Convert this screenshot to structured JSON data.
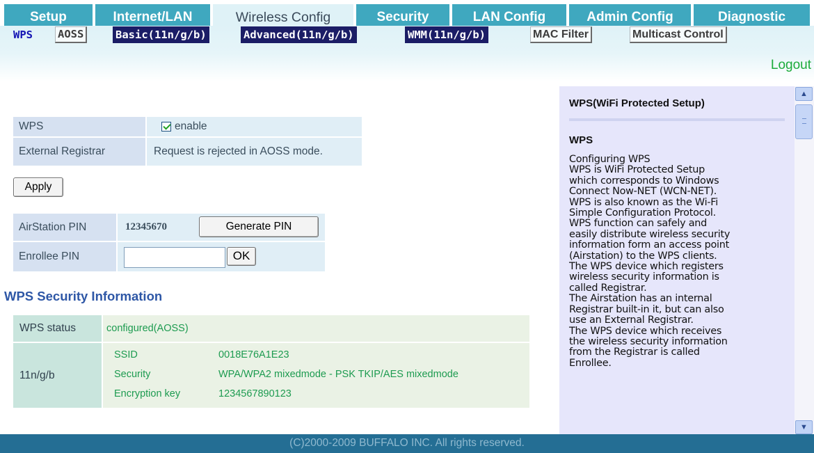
{
  "topnav": {
    "tabs": [
      {
        "label": "Setup",
        "active": false
      },
      {
        "label": "Internet/LAN",
        "active": false
      },
      {
        "label": "Wireless Config",
        "active": true
      },
      {
        "label": "Security",
        "active": false
      },
      {
        "label": "LAN Config",
        "active": false
      },
      {
        "label": "Admin Config",
        "active": false
      },
      {
        "label": "Diagnostic",
        "active": false
      }
    ]
  },
  "subnav": {
    "items": [
      {
        "label": "WPS",
        "style": "active"
      },
      {
        "label": "AOSS",
        "style": "plain"
      },
      {
        "label": "Basic(11n/g/b)",
        "style": "dark"
      },
      {
        "label": "Advanced(11n/g/b)",
        "style": "dark"
      },
      {
        "label": "WMM(11n/g/b)",
        "style": "dark"
      },
      {
        "label": "MAC Filter",
        "style": "plain-sans"
      },
      {
        "label": "Multicast Control",
        "style": "plain-sans"
      }
    ],
    "logout_label": "Logout"
  },
  "wps_form": {
    "wps_label": "WPS",
    "wps_enabled": true,
    "wps_enable_text": "enable",
    "external_registrar_label": "External Registrar",
    "external_registrar_value": "Request is rejected in AOSS mode.",
    "apply_label": "Apply",
    "airstation_pin_label": "AirStation PIN",
    "airstation_pin_value": "12345670",
    "generate_pin_label": "Generate PIN",
    "enrollee_pin_label": "Enrollee PIN",
    "enrollee_pin_value": "",
    "ok_label": "OK"
  },
  "security_info": {
    "title": "WPS Security Information",
    "status_label": "WPS status",
    "status_value": "configured(AOSS)",
    "band_label": "11n/g/b",
    "ssid_label": "SSID",
    "ssid_value": "0018E76A1E23",
    "security_label": "Security",
    "security_value": "WPA/WPA2 mixedmode - PSK TKIP/AES mixedmode",
    "key_label": "Encryption key",
    "key_value": "1234567890123"
  },
  "help": {
    "title": "WPS(WiFi Protected Setup)",
    "subtitle": "WPS",
    "lines": [
      "Configuring WPS",
      "WPS is WiFi Protected Setup",
      "which corresponds to Windows",
      "Connect Now-NET (WCN-NET).",
      "WPS is also known as the Wi-Fi",
      "Simple Configuration Protocol.",
      "WPS function can safely and",
      "easily distribute wireless security",
      "information form an access point",
      "(Airstation) to the WPS clients.",
      "The WPS device which registers",
      "wireless security information is",
      "called Registrar.",
      "The Airstation has an internal",
      "Registrar built-in it, but can also",
      "use an External Registrar.",
      "The WPS device which receives",
      "the wireless security information",
      "from the Registrar is called",
      "Enrollee."
    ]
  },
  "footer": {
    "copyright": "(C)2000-2009 BUFFALO INC. All rights reserved."
  },
  "colors": {
    "tab_bg": "#3fa8bf",
    "tab_active_bg": "#dff2f7",
    "footer_bg": "#246e94",
    "help_bg": "#e6e6fb",
    "status_text": "#1d9b50",
    "logout": "#1cab3b"
  },
  "icons": {
    "checkbox": "checked-checkbox",
    "scroll_up": "scroll-up-arrow-icon",
    "scroll_down": "scroll-down-arrow-icon"
  }
}
